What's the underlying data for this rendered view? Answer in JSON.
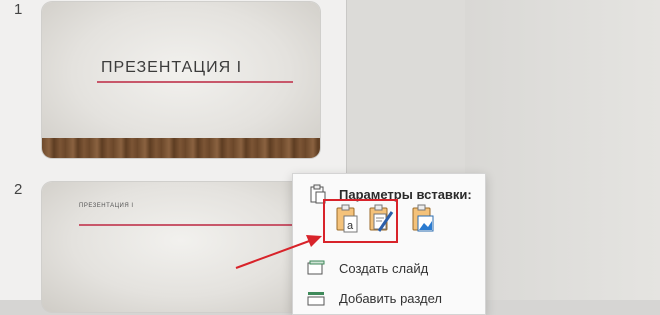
{
  "thumbnails": [
    {
      "number": "1",
      "title": "ПРЕЗЕНТАЦИЯ I"
    },
    {
      "number": "2",
      "title": "ПРЕЗЕНТАЦИЯ I"
    }
  ],
  "context_menu": {
    "paste_options_label": "Параметры вставки:",
    "paste_options": [
      "use-destination-theme",
      "keep-source-formatting",
      "picture"
    ],
    "items": [
      {
        "label": "Создать слайд",
        "icon": "new-slide-icon"
      },
      {
        "label": "Добавить раздел",
        "icon": "add-section-icon"
      }
    ]
  },
  "annotation_color": "#d8232a",
  "accent_line_color": "#c8576a"
}
